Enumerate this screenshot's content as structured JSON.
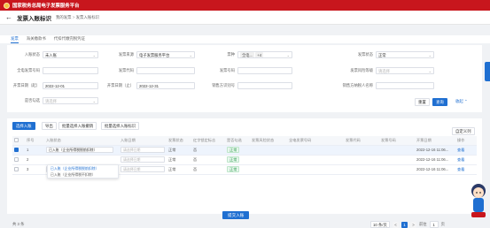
{
  "header": {
    "app_title": "国家税务总局电子发票服务平台"
  },
  "breadcrumb": {
    "back": "←",
    "title": "发票入账标识",
    "path1": "我的发票",
    "sep": ">",
    "path2": "发票入账标识"
  },
  "tabs": [
    {
      "label": "发票",
      "active": true
    },
    {
      "label": "海关缴款书",
      "active": false
    },
    {
      "label": "代扣代缴完税凭证",
      "active": false
    }
  ],
  "filters": {
    "entry_status": {
      "label": "入账状态",
      "value": "未入账"
    },
    "invoice_source": {
      "label": "发票来源",
      "value": "电子发票服务平台"
    },
    "ticket_type": {
      "label": "票种",
      "chip": "全电...",
      "chip2": "+4"
    },
    "invoice_status": {
      "label": "发票状态",
      "value": "正常"
    },
    "full_invoice_no": {
      "label": "全电发票号码",
      "placeholder": ""
    },
    "invoice_code": {
      "label": "发票代码",
      "placeholder": ""
    },
    "invoice_no": {
      "label": "发票号码",
      "placeholder": ""
    },
    "risk_level": {
      "label": "发票风险等级",
      "placeholder": "请选择"
    },
    "date_from": {
      "label": "开票日期（起）",
      "value": "2022-12-01"
    },
    "date_to": {
      "label": "开票日期（止）",
      "value": "2022-12-31"
    },
    "seller_tax_no": {
      "label": "销售方识别号",
      "placeholder": ""
    },
    "seller_name": {
      "label": "销售方纳税人名称",
      "placeholder": ""
    },
    "is_selected": {
      "label": "是否勾选",
      "placeholder": "请选择"
    }
  },
  "form_buttons": {
    "reset": "重置",
    "search": "查询",
    "collapse": "收起 ⌃"
  },
  "toolbar": {
    "batch_entry": "选择入账",
    "export": "导出",
    "batch_cancel": "批量选择入账撤销",
    "batch_mark": "批量选择入账标识",
    "custom_columns": "自定义列"
  },
  "table": {
    "columns": [
      "序号",
      "入账状态",
      "入账日期",
      "发票状态",
      "红字锁定标志",
      "是否勾选",
      "发票风险状态",
      "全电发票号码",
      "发票代码",
      "发票号码",
      "开票日期",
      "操作"
    ],
    "rows": [
      {
        "idx": "1",
        "entry": "已入账（企业所得税税前扣除）",
        "date_ph": "请选择日期",
        "status": "正常",
        "red_lock": "否",
        "checked": "正常",
        "open_date": "2022-12-16 11:06...",
        "ops": "查看",
        "selected": true
      },
      {
        "idx": "2",
        "entry": "",
        "date_ph": "请选择日期",
        "status": "正常",
        "red_lock": "否",
        "checked": "正常",
        "open_date": "2022-12-16 11:06...",
        "ops": "查看",
        "selected": false
      },
      {
        "idx": "3",
        "entry": "已入账（企业所得税税前扣除）",
        "date_ph": "请选择日期",
        "status": "正常",
        "red_lock": "否",
        "checked": "正常",
        "open_date": "2022-12-16 11:06...",
        "ops": "查看",
        "selected": false
      }
    ]
  },
  "dropdown": {
    "options": [
      "已入账（企业所得税税前扣除）",
      "已入账（企业所得税不扣除）"
    ]
  },
  "pagination": {
    "total": "共 3 条",
    "page_size": "10 条/页",
    "prev": "<",
    "page": "1",
    "next": ">",
    "goto_label": "前往",
    "goto_value": "1",
    "page_unit": "页"
  },
  "footer": {
    "submit": "提交入账"
  },
  "colors": {
    "primary": "#1f6fd1",
    "header": "#c8161d",
    "success": "#2e9e4f"
  }
}
